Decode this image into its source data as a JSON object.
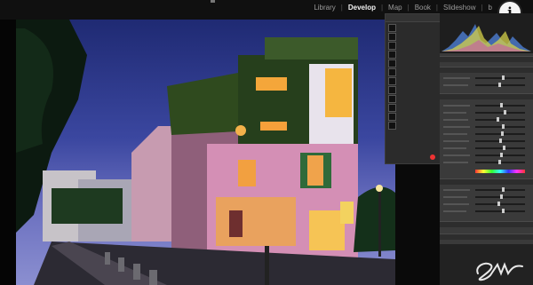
{
  "app": {
    "modules": [
      "Library",
      "Develop",
      "Map",
      "Book",
      "Slideshow",
      "b"
    ],
    "active_module": "Develop",
    "info_button": "i"
  },
  "snapshots": [
    "",
    "",
    "",
    "",
    "",
    "",
    "",
    "",
    "",
    "",
    "",
    ""
  ],
  "colors": {
    "accent": "#f2f2f2",
    "panel_bg": "#3a3a3a",
    "dark_bg": "#0a0a0a",
    "record": "#e33333"
  },
  "icons": [
    "info-icon",
    "histogram-icon",
    "signature-logo"
  ]
}
